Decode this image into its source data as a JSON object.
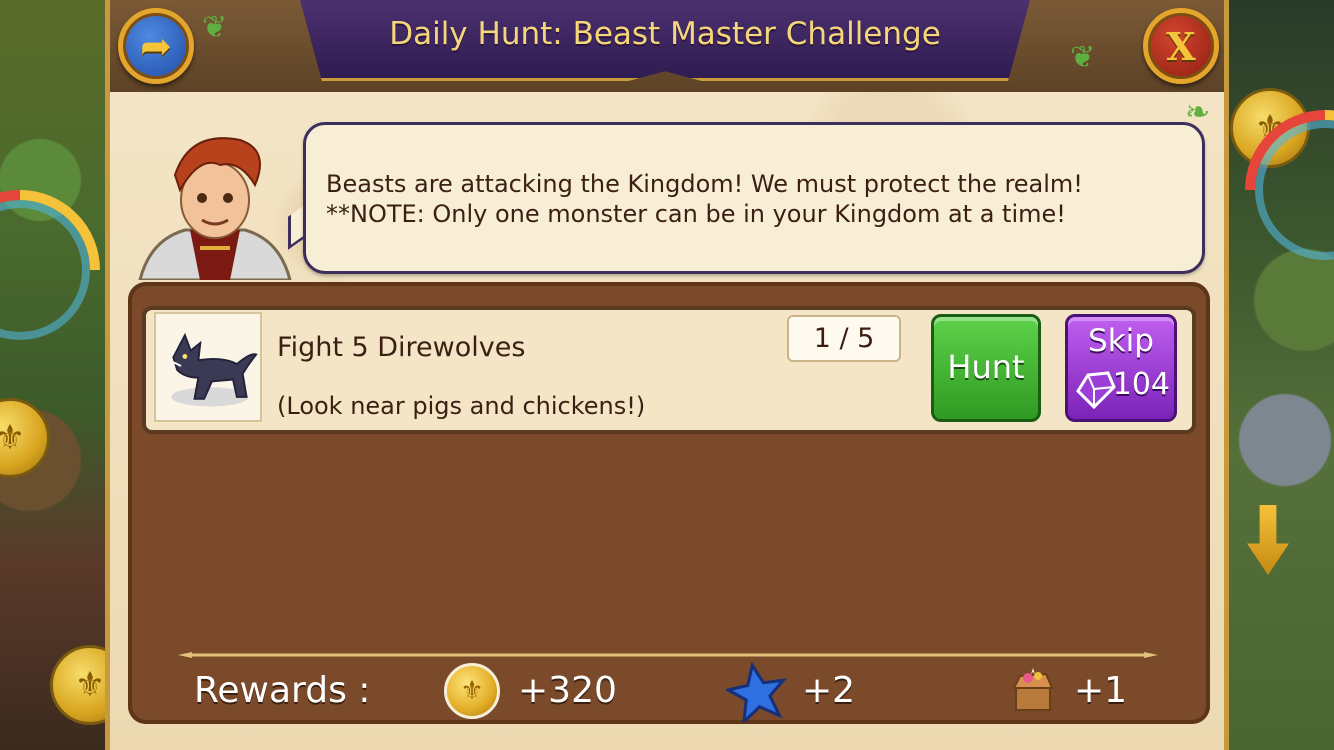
{
  "header": {
    "title": "Daily Hunt: Beast Master Challenge",
    "back_icon": "back-arrow-icon",
    "close_icon": "close-x-icon"
  },
  "speech": {
    "line1": "Beasts are attacking the Kingdom! We must protect the realm!",
    "line2": "**NOTE: Only one monster can be in your Kingdom at a time!"
  },
  "task": {
    "title": "Fight 5 Direwolves",
    "hint": "(Look near pigs and chickens!)",
    "progress": "1 / 5",
    "hunt_label": "Hunt",
    "skip_label": "Skip",
    "skip_cost": "104"
  },
  "rewards": {
    "label": "Rewards :",
    "coins": "+320",
    "stars": "+2",
    "chest": "+1"
  },
  "colors": {
    "title_banner": "#3a2460",
    "hunt_button": "#3fae2e",
    "skip_button": "#9b3fd6",
    "panel_brown": "#7a4a2a"
  }
}
